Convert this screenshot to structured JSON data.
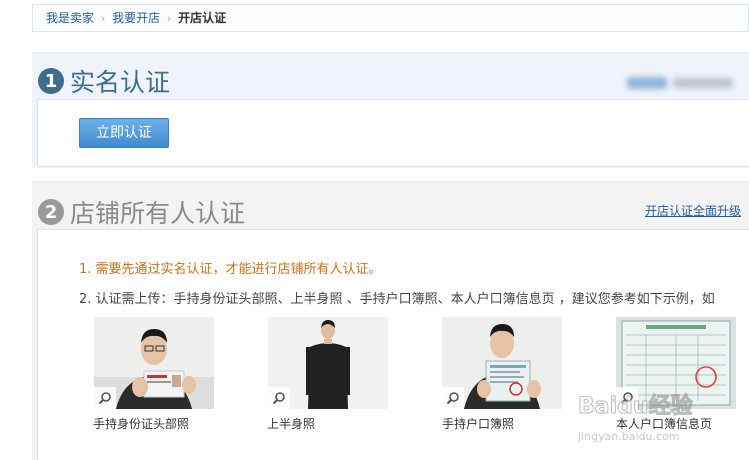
{
  "breadcrumb": {
    "items": [
      "我是卖家",
      "我要开店"
    ],
    "current": "开店认证",
    "separator": "›"
  },
  "step1": {
    "number": "1",
    "title": "实名认证",
    "button_label": "立即认证"
  },
  "step2": {
    "number": "2",
    "title": "店铺所有人认证",
    "upgrade_link": "开店认证全面升级",
    "notice": "1. 需要先通过实名认证，才能进行店铺所有人认证。",
    "requirement": "2. 认证需上传：手持身份证头部照、上半身照 、手持户口簿照、本人户口簿信息页 ，建议您参考如下示例，如",
    "examples": [
      {
        "caption": "手持身份证头部照",
        "icon": "zoom-icon"
      },
      {
        "caption": "上半身照",
        "icon": "zoom-icon"
      },
      {
        "caption": "手持户口簿照",
        "icon": "zoom-icon"
      },
      {
        "caption": "本人户口簿信息页",
        "icon": "zoom-icon"
      }
    ]
  },
  "watermark": {
    "brand": "Baidu经验",
    "url": "jingyan.baidu.com"
  },
  "colors": {
    "accent_blue": "#3f6d8e",
    "link": "#1f5e9c",
    "notice": "#c4731d",
    "button": "#4a94d6"
  }
}
